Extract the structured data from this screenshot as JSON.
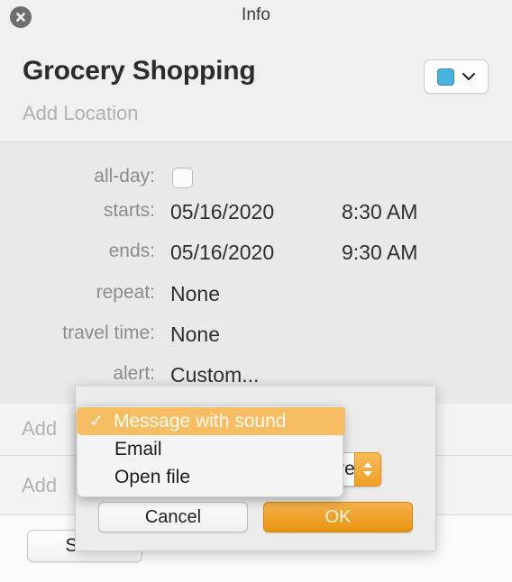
{
  "window": {
    "title": "Info",
    "close_icon": "close-circle-icon"
  },
  "event": {
    "title": "Grocery Shopping",
    "location_placeholder": "Add Location",
    "calendar_color": "#4bb3e0",
    "calendar_chevron_icon": "chevron-down-icon"
  },
  "fields": [
    {
      "label": "all-day:",
      "type": "checkbox",
      "checked": false
    },
    {
      "label": "starts:",
      "value": "05/16/2020",
      "value2": "8:30 AM"
    },
    {
      "label": "ends:",
      "value": "05/16/2020",
      "value2": "9:30 AM"
    },
    {
      "label": "repeat:",
      "value": "None"
    },
    {
      "label": "travel time:",
      "value": "None"
    },
    {
      "label": "alert:",
      "value": "Custom..."
    }
  ],
  "background_rows": [
    {
      "label": "Add"
    },
    {
      "label": "Add"
    }
  ],
  "show_button": {
    "label": "Sh..."
  },
  "alert_sheet": {
    "stepper_value": "...ore",
    "stepper_icon": "up-down-stepper-icon",
    "cancel_label": "Cancel",
    "ok_label": "OK",
    "ok_color": "#e8940f"
  },
  "alert_menu": {
    "highlight_color": "#f7bd62",
    "check_icon": "checkmark-icon",
    "items": [
      {
        "label": "Message with sound",
        "selected": true
      },
      {
        "label": "Email",
        "selected": false
      },
      {
        "label": "Open file",
        "selected": false
      }
    ]
  }
}
